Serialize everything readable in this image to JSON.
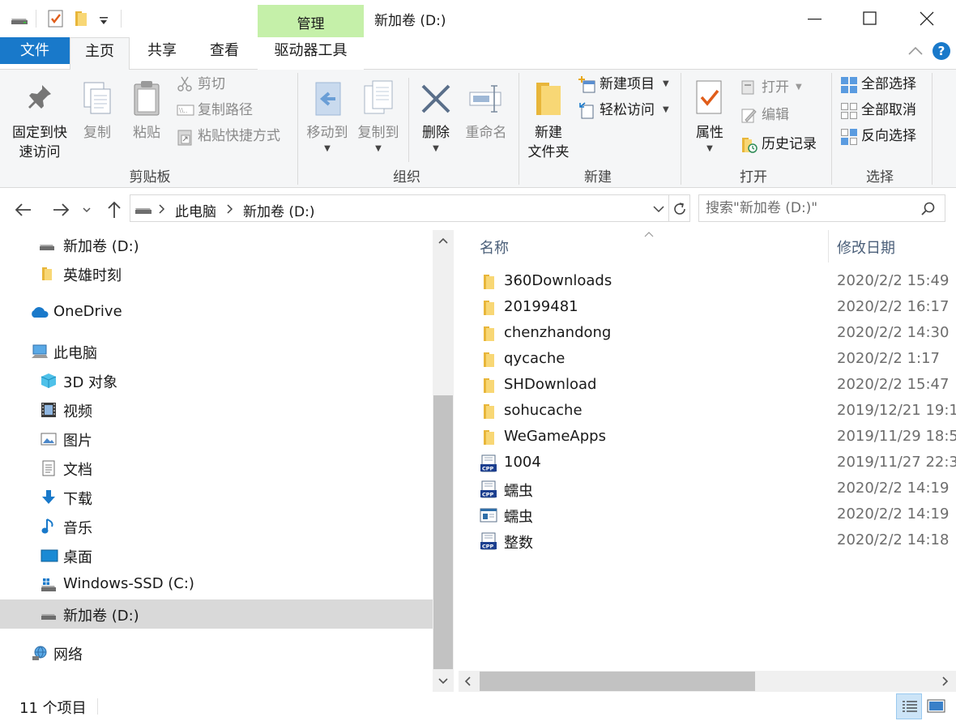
{
  "titlebar": {
    "context_tab": "管理",
    "window_title": "新加卷 (D:)"
  },
  "ribbon_tabs": {
    "file": "文件",
    "home": "主页",
    "share": "共享",
    "view": "查看",
    "drive_tools": "驱动器工具"
  },
  "ribbon": {
    "clipboard": {
      "group": "剪贴板",
      "pin_line1": "固定到快",
      "pin_line2": "速访问",
      "copy": "复制",
      "paste": "粘贴",
      "cut": "剪切",
      "copy_path": "复制路径",
      "paste_shortcut": "粘贴快捷方式"
    },
    "organize": {
      "group": "组织",
      "move_to": "移动到",
      "copy_to": "复制到",
      "delete": "删除",
      "rename": "重命名"
    },
    "new": {
      "group": "新建",
      "new_folder_line1": "新建",
      "new_folder_line2": "文件夹",
      "new_item": "新建项目",
      "easy_access": "轻松访问"
    },
    "open": {
      "group": "打开",
      "properties": "属性",
      "open": "打开",
      "edit": "编辑",
      "history": "历史记录"
    },
    "select": {
      "group": "选择",
      "select_all": "全部选择",
      "select_none": "全部取消",
      "invert": "反向选择"
    }
  },
  "address": {
    "seg1": "此电脑",
    "seg2": "新加卷 (D:)",
    "search_placeholder": "搜索\"新加卷 (D:)\""
  },
  "nav": [
    {
      "label": "新加卷 (D:)",
      "icon": "drive-icon"
    },
    {
      "label": "英雄时刻",
      "icon": "folder-icon"
    },
    {
      "label": "OneDrive",
      "icon": "onedrive-icon"
    },
    {
      "label": "此电脑",
      "icon": "computer-icon"
    },
    {
      "label": "3D 对象",
      "icon": "3d-objects-icon"
    },
    {
      "label": "视频",
      "icon": "video-icon"
    },
    {
      "label": "图片",
      "icon": "pictures-icon"
    },
    {
      "label": "文档",
      "icon": "documents-icon"
    },
    {
      "label": "下载",
      "icon": "download-icon"
    },
    {
      "label": "音乐",
      "icon": "music-icon"
    },
    {
      "label": "桌面",
      "icon": "desktop-icon"
    },
    {
      "label": "Windows-SSD (C:)",
      "icon": "system-drive-icon"
    },
    {
      "label": "新加卷 (D:)",
      "icon": "drive-icon"
    },
    {
      "label": "网络",
      "icon": "network-icon"
    }
  ],
  "columns": {
    "name": "名称",
    "modified": "修改日期"
  },
  "files": [
    {
      "name": "360Downloads",
      "date": "2020/2/2 15:49",
      "icon": "folder-icon"
    },
    {
      "name": "20199481",
      "date": "2020/2/2 16:17",
      "icon": "folder-icon"
    },
    {
      "name": "chenzhandong",
      "date": "2020/2/2 14:30",
      "icon": "folder-icon"
    },
    {
      "name": "qycache",
      "date": "2020/2/2 1:17",
      "icon": "folder-icon"
    },
    {
      "name": "SHDownload",
      "date": "2020/2/2 15:47",
      "icon": "folder-icon"
    },
    {
      "name": "sohucache",
      "date": "2019/12/21 19:1",
      "icon": "folder-icon"
    },
    {
      "name": "WeGameApps",
      "date": "2019/11/29 18:5",
      "icon": "folder-icon"
    },
    {
      "name": "1004",
      "date": "2019/11/27 22:3",
      "icon": "cpp-file-icon"
    },
    {
      "name": "蠕虫",
      "date": "2020/2/2 14:19",
      "icon": "cpp-file-icon"
    },
    {
      "name": "蠕虫",
      "date": "2020/2/2 14:19",
      "icon": "exe-file-icon"
    },
    {
      "name": "整数",
      "date": "2020/2/2 14:18",
      "icon": "cpp-file-icon"
    }
  ],
  "status": {
    "count": "11 个项目"
  },
  "colors": {
    "accent": "#1979ca",
    "context_tab": "#c5f0a9",
    "folder": "#f8d775",
    "selected_row": "#d9d9d9"
  }
}
